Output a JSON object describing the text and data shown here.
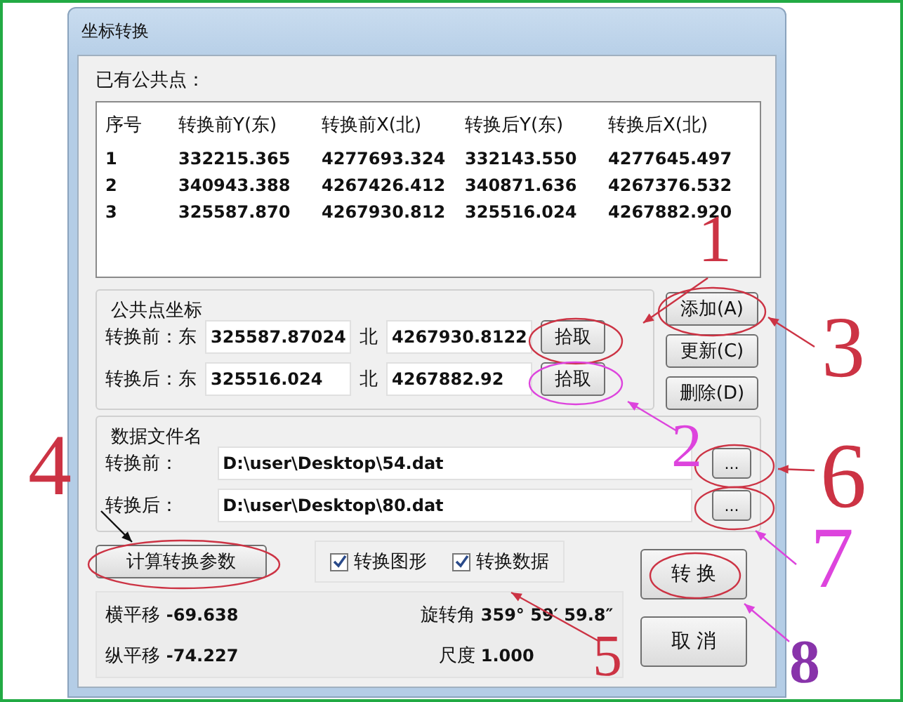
{
  "window": {
    "title": "坐标转换"
  },
  "common_points": {
    "label": "已有公共点：",
    "columns": [
      "序号",
      "转换前Y(东)",
      "转换前X(北)",
      "转换后Y(东)",
      "转换后X(北)"
    ],
    "rows": [
      [
        "1",
        "332215.365",
        "4277693.324",
        "332143.550",
        "4277645.497"
      ],
      [
        "2",
        "340943.388",
        "4267426.412",
        "340871.636",
        "4267376.532"
      ],
      [
        "3",
        "325587.870",
        "4267930.812",
        "325516.024",
        "4267882.920"
      ]
    ]
  },
  "coordinates": {
    "title": "公共点坐标",
    "rows": [
      {
        "label": "转换前：东",
        "east": "325587.87024",
        "north_label": "北",
        "north": "4267930.8122",
        "pick": "拾取"
      },
      {
        "label": "转换后：东",
        "east": "325516.024",
        "north_label": "北",
        "north": "4267882.92",
        "pick": "拾取"
      }
    ]
  },
  "actions": [
    "添加(A)",
    "更新(C)",
    "删除(D)"
  ],
  "files": {
    "title": "数据文件名",
    "rows": [
      {
        "label": "转换前：",
        "path": "D:\\user\\Desktop\\54.dat",
        "browse": "..."
      },
      {
        "label": "转换后：",
        "path": "D:\\user\\Desktop\\80.dat",
        "browse": "..."
      }
    ]
  },
  "compute_button": "计算转换参数",
  "options": [
    {
      "label": "转换图形",
      "checked": true
    },
    {
      "label": "转换数据",
      "checked": true
    }
  ],
  "results": [
    {
      "label": "横平移",
      "value": "-69.638"
    },
    {
      "label": "旋转角",
      "value": "359°  59′  59.8″"
    },
    {
      "label": "纵平移",
      "value": "-74.227"
    },
    {
      "label": "尺度",
      "value": "1.000"
    }
  ],
  "buttons": [
    "转  换",
    "取  消"
  ],
  "annotations": [
    {
      "text": "1",
      "color": "#cc3344"
    },
    {
      "text": "2",
      "color": "#dd44dd"
    },
    {
      "text": "3",
      "color": "#cc3344"
    },
    {
      "text": "4",
      "color": "#cc3344"
    },
    {
      "text": "5",
      "color": "#cc3344"
    },
    {
      "text": "6",
      "color": "#cc3344"
    },
    {
      "text": "7",
      "color": "#dd44dd"
    },
    {
      "text": "8",
      "color": "#8833aa"
    }
  ]
}
